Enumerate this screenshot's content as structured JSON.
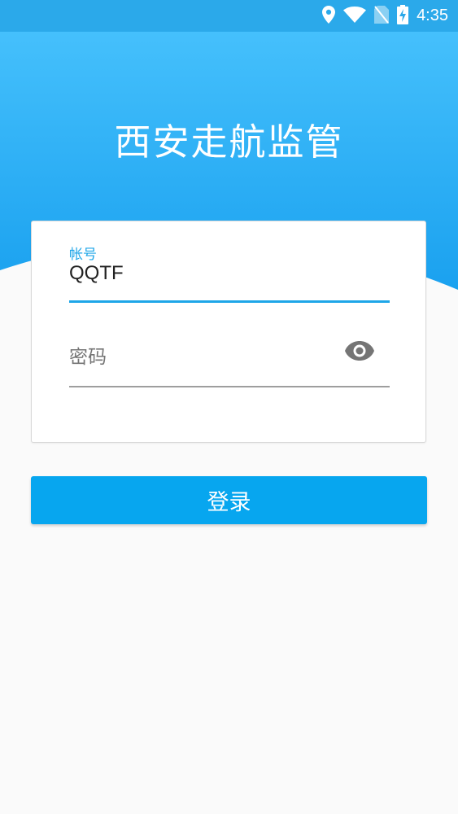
{
  "status_bar": {
    "time": "4:35",
    "icons": [
      "location-icon",
      "wifi-icon",
      "no-sim-icon",
      "battery-charging-icon"
    ]
  },
  "header": {
    "title": "西安走航监管"
  },
  "login_form": {
    "account_label": "帐号",
    "account_value": "QQTF",
    "password_placeholder": "密码",
    "password_toggle_icon": "eye-icon"
  },
  "actions": {
    "login_label": "登录"
  },
  "colors": {
    "status_bar": "#2ba9ea",
    "header_gradient_top": "#45c0fc",
    "header_gradient_bottom": "#1aa1ef",
    "accent": "#1ea6e8",
    "button": "#07a6ef",
    "background": "#fafafa"
  }
}
